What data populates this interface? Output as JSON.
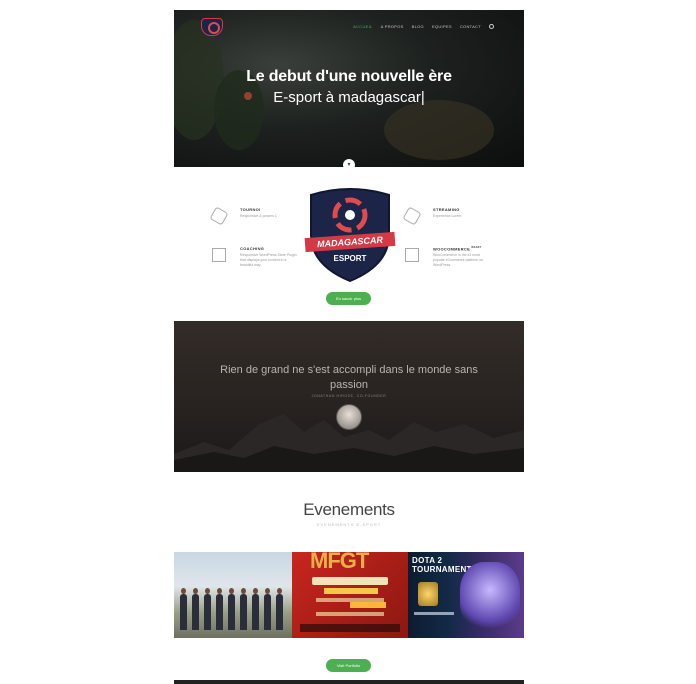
{
  "hero": {
    "title_line1": "Le debut d'une nouvelle ère",
    "title_line2": "E-sport à madagascar|",
    "nav": [
      "ACCUEIL",
      "A PROPOS",
      "BLOG",
      "EQUIPES",
      "CONTACT"
    ],
    "active_nav": "ACCUEIL",
    "down_arrow": "▾"
  },
  "features": {
    "items": [
      {
        "title": "TOURNOI",
        "desc": "Responsive & powers 1"
      },
      {
        "title": "COACHING",
        "desc": "Responsive WordPress Store Plugin that displays your content in a beautiful way."
      },
      {
        "title": "STREAMING",
        "desc": "Experience Lorem"
      },
      {
        "title": "WOOCOMMERCE",
        "desc": "WooCommerce is the #1 most popular eCommerce platform on WordPress."
      }
    ],
    "woocommerce_badge": "READY",
    "logo_text_top": "MADAGASCAR",
    "logo_text_bottom": "ESPORT",
    "cta": "En savoir plus"
  },
  "quote": {
    "text": "Rien de grand ne s'est accompli dans le monde sans passion",
    "author": "JONATHAN HIROSE, CO-FOUNDER"
  },
  "events": {
    "title": "Evenements",
    "subtitle": "EVENEMENTS E-SPORT",
    "gallery": {
      "mfgt": "MFGT",
      "dota_line1": "DOTA 2",
      "dota_line2": "TOURNAMENT"
    },
    "portfolio_button": "Visit Portfolio"
  },
  "colors": {
    "accent": "#4caf50",
    "shield_blue": "#1c2447",
    "shield_red": "#d33a45"
  }
}
